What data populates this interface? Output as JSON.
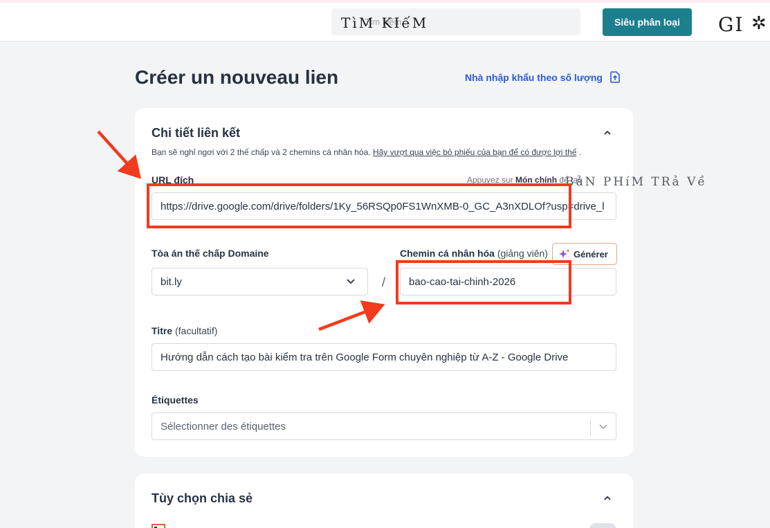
{
  "topbar": {
    "search_placeholder": "Tìm kiếm",
    "search_overlay": "TìM KIếM",
    "button_label": "Siêu phân loại",
    "overlay_text": "GI"
  },
  "header": {
    "page_title": "Créer un nouveau lien",
    "bulk_import_label": "Nhà nhập khẩu theo số lượng"
  },
  "link_details": {
    "title": "Chi tiết liên kết",
    "desc_text": "Bạn sẽ nghỉ ngơi với 2 thế chấp và 2 chemins cá nhân hóa.",
    "desc_link": "Hãy vượt qua việc bỏ phiếu của bạn để có được lợi thế",
    "desc_end": ".",
    "url_label": "URL đích",
    "url_hint_prefix": "Appuyez sur",
    "url_hint_bold": "Món chính",
    "url_hint_suffix": "để tạo",
    "url_hint_overlay": "BảN PHíM TRả Về",
    "url_value": "https://drive.google.com/drive/folders/1Ky_56RSQp0FS1WnXMB-0_GC_A3nXDLOf?usp=drive_l",
    "domain_label": "Tòa án thế chấp Domaine",
    "domain_value": "bit.ly",
    "slash": "/",
    "custom_path_label": "Chemin cá nhân hóa",
    "custom_path_label_note": "(giảng viên)",
    "generate_label": "Générer",
    "custom_path_value": "bao-cao-tai-chinh-2026",
    "title_label": "Titre",
    "title_label_note": "(facultatif)",
    "title_value": "Hướng dẫn cách tạo bài kiểm tra trên Google Form chuyên nghiệp từ A-Z - Google Drive",
    "tags_label": "Étiquettes",
    "tags_placeholder": "Sélectionner des étiquettes"
  },
  "sharing": {
    "title": "Tùy chọn chia sẻ"
  },
  "colors": {
    "accent_teal": "#1c7f8e",
    "link_blue": "#2a5bd7",
    "annotation_red": "#f23a1d"
  },
  "icons": [
    "upload-icon",
    "chevron-up-icon",
    "chevron-down-icon",
    "sparkle-icon",
    "qr-icon",
    "toggle-switch",
    "arrow-annotation"
  ]
}
